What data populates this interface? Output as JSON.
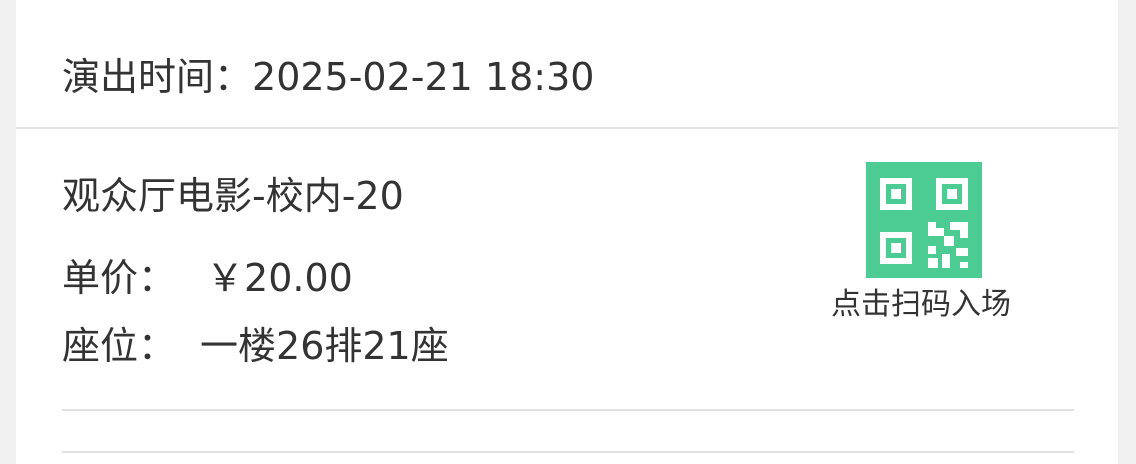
{
  "performance": {
    "label": "演出时间：",
    "datetime": "2025-02-21 18:30"
  },
  "ticket": {
    "title": "观众厅电影-校内-20",
    "price_label": "单价：",
    "price_value": "￥20.00",
    "seat_label": "座位：",
    "seat_value": "一楼26排21座"
  },
  "entry": {
    "label": "点击扫码入场",
    "icon": "qr-code-icon"
  },
  "colors": {
    "accent": "#4ccc93",
    "text": "#333333",
    "divider": "#e6e6e6"
  }
}
